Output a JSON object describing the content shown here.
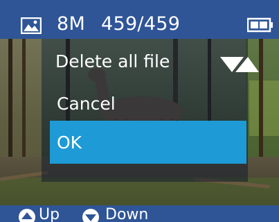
{
  "status_bar": {
    "photo_icon": "photo-icon",
    "resolution": "8M",
    "counter": "459/459",
    "battery_icon": "battery-icon"
  },
  "dialog": {
    "title": "Delete all file",
    "expand_icon": "triangle-down-icon",
    "options": [
      {
        "label": "Cancel",
        "selected": false
      },
      {
        "label": "OK",
        "selected": true
      }
    ]
  },
  "hint_bar": {
    "up_label": "Up",
    "down_label": "Down",
    "up_icon": "circle-up-arrow-icon",
    "down_icon": "circle-down-arrow-icon"
  },
  "colors": {
    "bar_background": "#2f5597",
    "highlight": "#1e9ad6",
    "text": "#ffffff"
  }
}
